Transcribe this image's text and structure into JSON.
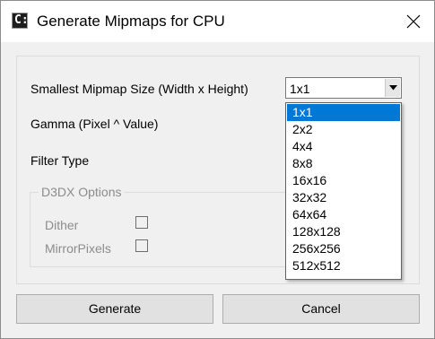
{
  "window": {
    "title": "Generate Mipmaps for CPU",
    "app_icon_glyph": "C:",
    "close_icon": "close-icon"
  },
  "form": {
    "smallest_mipmap_label": "Smallest Mipmap Size (Width x Height)",
    "smallest_mipmap_value": "1x1",
    "gamma_label": "Gamma (Pixel ^ Value)",
    "filter_type_label": "Filter Type"
  },
  "d3dx_options": {
    "group_label": "D3DX Options",
    "dither_label": "Dither",
    "dither_checked": false,
    "mirror_pixels_label": "MirrorPixels",
    "mirror_pixels_checked": false
  },
  "dropdown": {
    "selected_index": 0,
    "options": [
      "1x1",
      "2x2",
      "4x4",
      "8x8",
      "16x16",
      "32x32",
      "64x64",
      "128x128",
      "256x256",
      "512x512"
    ]
  },
  "buttons": {
    "generate": "Generate",
    "cancel": "Cancel"
  },
  "colors": {
    "selection": "#0078d7",
    "dialog_bg": "#f0f0f0",
    "disabled_text": "#8c8c8c"
  }
}
